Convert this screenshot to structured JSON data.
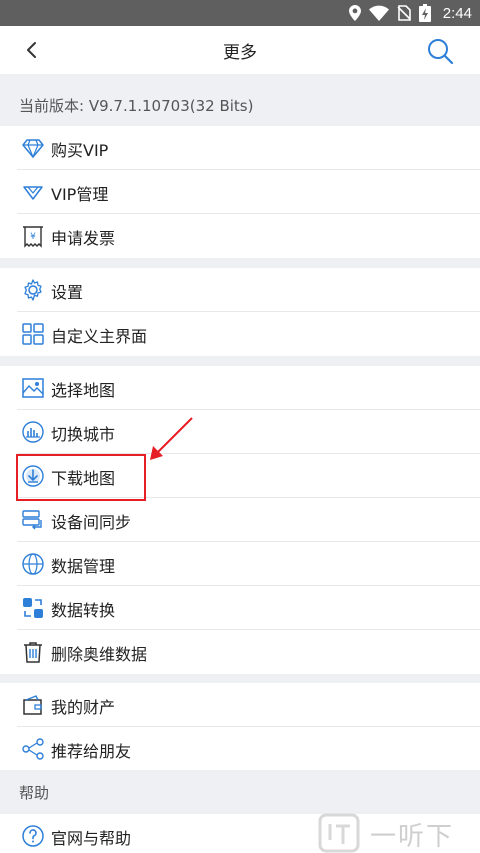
{
  "status": {
    "time": "2:44"
  },
  "header": {
    "title": "更多"
  },
  "version_text": "当前版本: V9.7.1.10703(32 Bits)",
  "groups": [
    {
      "items": [
        {
          "label": "购买VIP"
        },
        {
          "label": "VIP管理"
        },
        {
          "label": "申请发票"
        }
      ]
    },
    {
      "items": [
        {
          "label": "设置"
        },
        {
          "label": "自定义主界面"
        }
      ]
    },
    {
      "items": [
        {
          "label": "选择地图"
        },
        {
          "label": "切换城市"
        },
        {
          "label": "下载地图"
        },
        {
          "label": "设备间同步"
        },
        {
          "label": "数据管理"
        },
        {
          "label": "数据转换"
        },
        {
          "label": "删除奥维数据"
        }
      ]
    },
    {
      "items": [
        {
          "label": "我的财产"
        },
        {
          "label": "推荐给朋友"
        }
      ]
    }
  ],
  "help": {
    "section_label": "帮助",
    "items": [
      {
        "label": "官网与帮助"
      }
    ]
  },
  "watermark": {
    "text": "一听下载"
  },
  "colors": {
    "accent": "#2e7fd8",
    "highlight": "#e51f25",
    "background": "#eef0f4"
  }
}
